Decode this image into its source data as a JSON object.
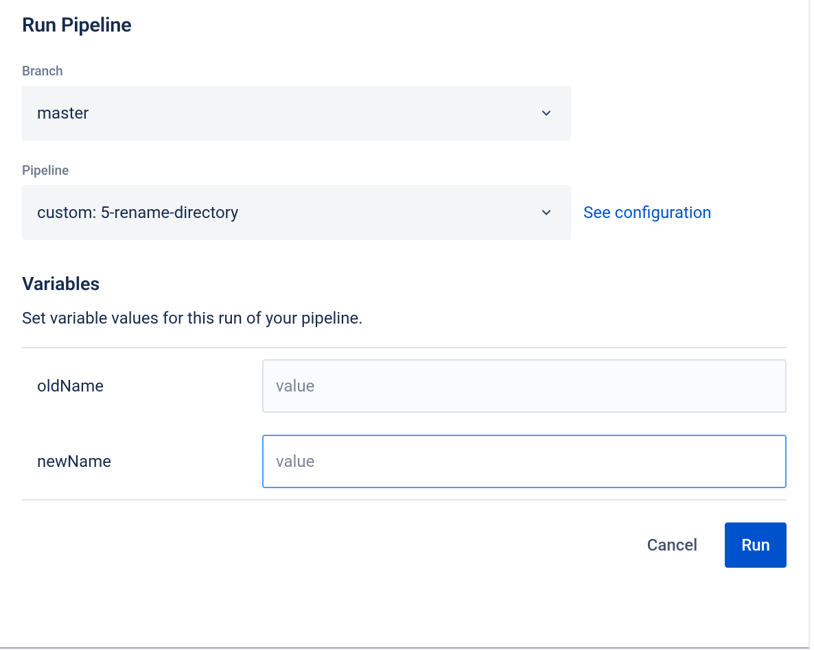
{
  "title": "Run Pipeline",
  "branch": {
    "label": "Branch",
    "value": "master"
  },
  "pipeline": {
    "label": "Pipeline",
    "value": "custom: 5-rename-directory",
    "config_link_label": "See configuration"
  },
  "variables": {
    "title": "Variables",
    "description": "Set variable values for this run of your pipeline.",
    "placeholder": "value",
    "items": [
      {
        "name": "oldName"
      },
      {
        "name": "newName"
      }
    ]
  },
  "actions": {
    "cancel": "Cancel",
    "run": "Run"
  }
}
